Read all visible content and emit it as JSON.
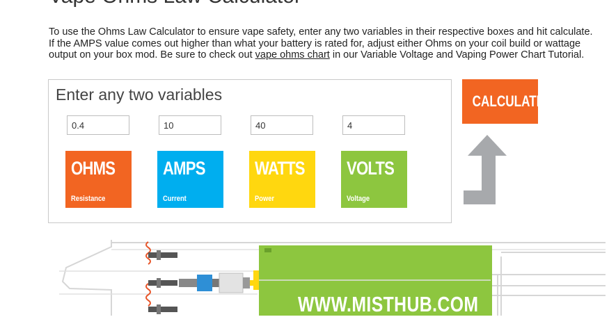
{
  "page": {
    "title": "Vape Ohms Law Calculator",
    "intro_before_link": "To use the Ohms Law Calculator to ensure vape safety, enter any two variables in their respective boxes and hit calculate. If the AMPS value comes out higher than what your battery is rated for, adjust either Ohms on your coil build or wattage output on your box mod. Be sure to check out ",
    "intro_link": "vape ohms chart",
    "intro_after_link": " in our Variable Voltage and Vaping Power Chart Tutorial."
  },
  "calculator": {
    "heading": "Enter any two variables",
    "inputs": [
      {
        "value": "0.4"
      },
      {
        "value": "10"
      },
      {
        "value": "40"
      },
      {
        "value": "4"
      }
    ],
    "tiles": [
      {
        "name": "OHMS",
        "sub": "Resistance",
        "color": "#f26522"
      },
      {
        "name": "AMPS",
        "sub": "Current",
        "color": "#00aeef"
      },
      {
        "name": "WATTS",
        "sub": "Power",
        "color": "#ffd70f"
      },
      {
        "name": "VOLTS",
        "sub": "Voltage",
        "color": "#8dc63f"
      }
    ],
    "button_label": "CALCULATE"
  },
  "diagram": {
    "brand_text": "WWW.MISTHUB.COM",
    "battery_color": "#8dc63f"
  },
  "colors": {
    "arrow": "#a7a9ac",
    "button": "#f26522"
  }
}
